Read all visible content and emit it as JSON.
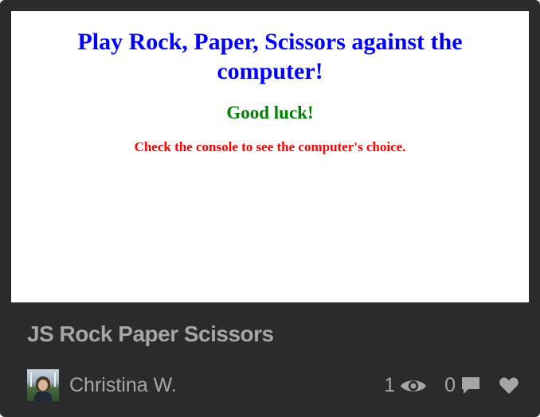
{
  "preview": {
    "title": "Play Rock, Paper, Scissors against the computer!",
    "subtitle": "Good luck!",
    "note": "Check the console to see the computer's choice.",
    "title_color": "#0000ff",
    "subtitle_color": "#008000",
    "note_color": "#ff0000"
  },
  "pen": {
    "title": "JS Rock Paper Scissors",
    "author": "Christina W.",
    "avatar_icon": "avatar-photo"
  },
  "stats": {
    "views": "1",
    "views_icon": "eye-icon",
    "comments": "0",
    "comments_icon": "comment-icon",
    "likes_icon": "heart-icon"
  },
  "colors": {
    "card_background": "#2b2b2d",
    "muted_text": "#a6a6a6"
  }
}
